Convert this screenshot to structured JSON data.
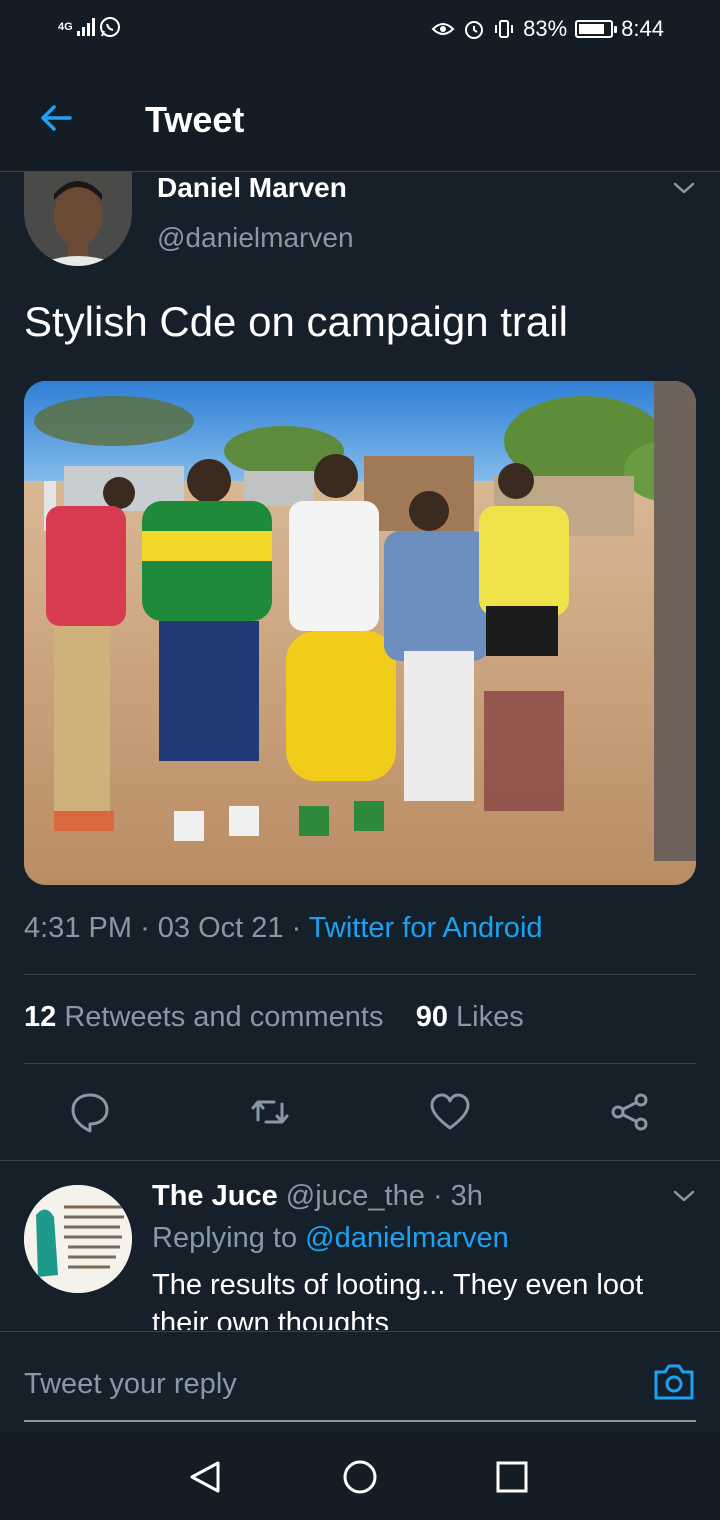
{
  "status_bar": {
    "network": "4G",
    "battery": "83%",
    "battery_level": 0.83,
    "time": "8:44"
  },
  "header": {
    "title": "Tweet"
  },
  "tweet": {
    "author_name": "Daniel Marven",
    "author_handle": "@danielmarven",
    "text": "Stylish Cde on campaign trail",
    "time": "4:31 PM",
    "date": "03 Oct 21",
    "source": "Twitter for Android",
    "retweets_count": "12",
    "retweets_label": "Retweets and comments",
    "likes_count": "90",
    "likes_label": "Likes"
  },
  "reply": {
    "author_name": "The Juce",
    "author_handle": "@juce_the",
    "age": "3h",
    "replying_label": "Replying to",
    "replying_handle": "@danielmarven",
    "text": "The results of looting... They even loot their own thoughts"
  },
  "composer": {
    "placeholder": "Tweet your reply"
  },
  "colors": {
    "background": "#15202b",
    "accent": "#1da1f2",
    "secondary_text": "#8899a6",
    "divider": "#38444d"
  }
}
